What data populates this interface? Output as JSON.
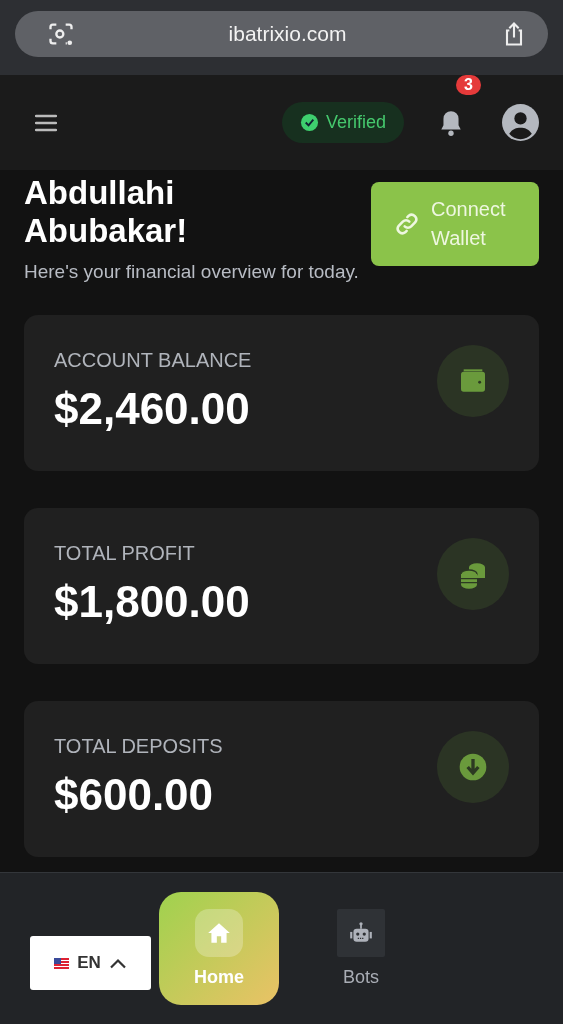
{
  "browser": {
    "url": "ibatrixio.com"
  },
  "header": {
    "badge": "Verified",
    "notification_count": "3"
  },
  "greeting": {
    "name": "Abdullahi Abubakar!",
    "subtitle": "Here's your financial overview for today.",
    "button": "Connect Wallet"
  },
  "cards": [
    {
      "kind": "wallet",
      "label": "ACCOUNT BALANCE",
      "amount": "$2,460.00"
    },
    {
      "kind": "coins",
      "label": "TOTAL PROFIT",
      "amount": "$1,800.00"
    },
    {
      "kind": "deposit",
      "label": "TOTAL DEPOSITS",
      "amount": "$600.00"
    }
  ],
  "language": {
    "code": "EN"
  },
  "nav": [
    {
      "kind": "home",
      "label": "Home",
      "selected": true
    },
    {
      "kind": "bot",
      "label": "Bots",
      "selected": false
    }
  ]
}
